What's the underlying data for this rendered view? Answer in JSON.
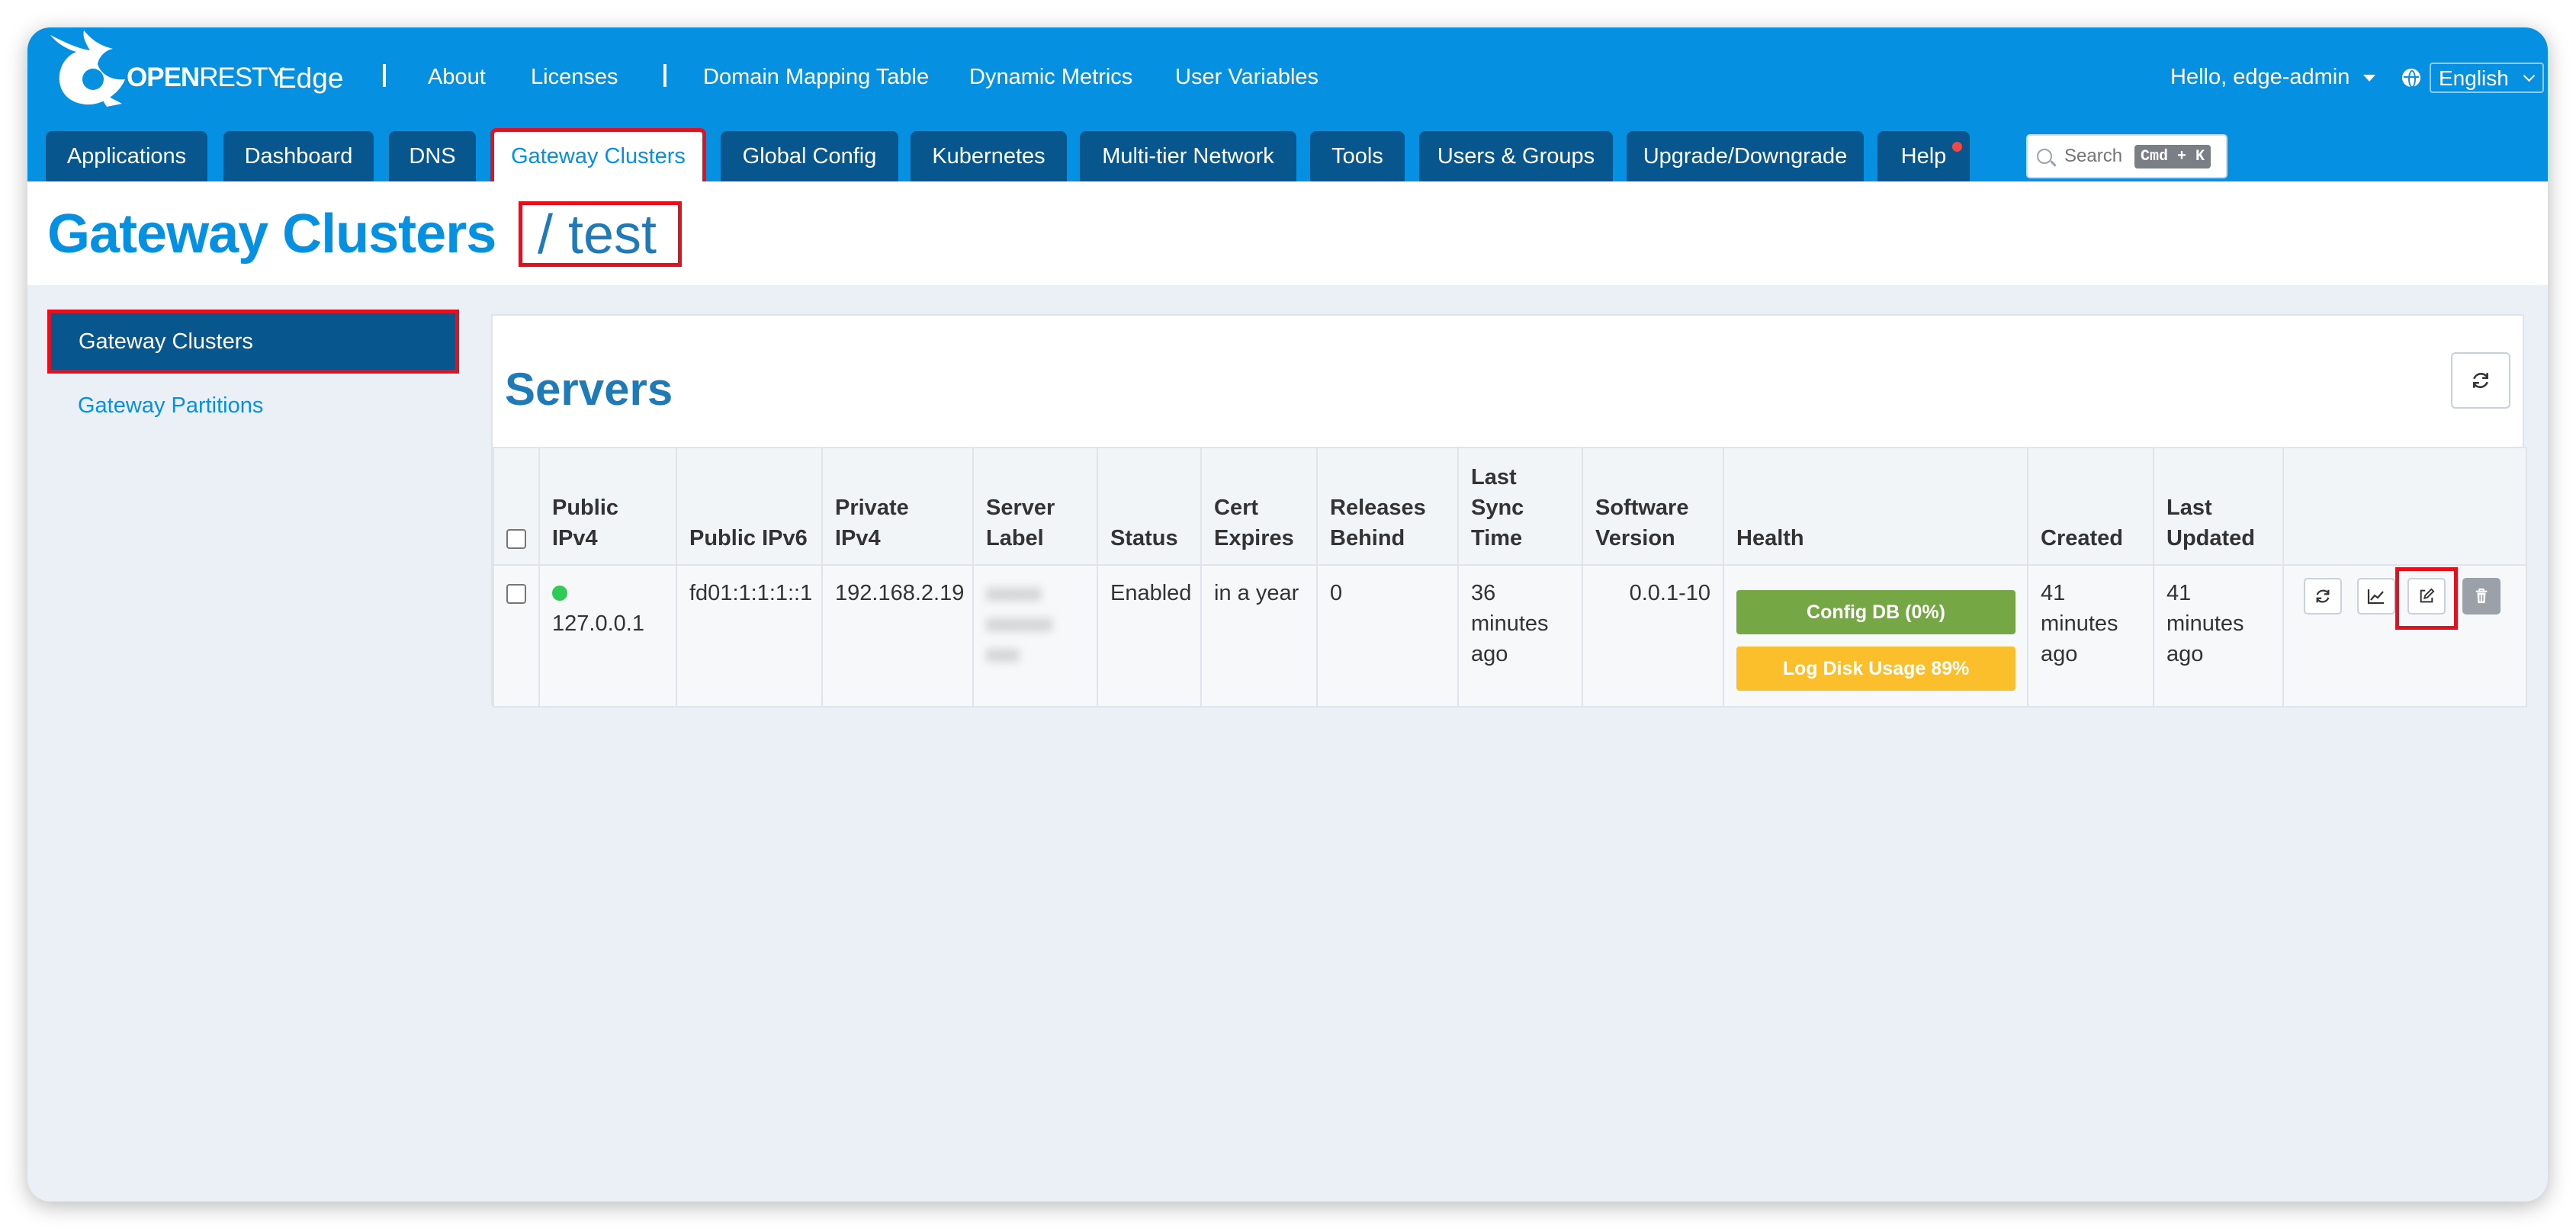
{
  "brand": {
    "logo_main": "OPEN",
    "logo_light": "RESTY",
    "product": "Edge"
  },
  "top_links": [
    "About",
    "Licenses",
    "Domain Mapping Table",
    "Dynamic Metrics",
    "User Variables"
  ],
  "user": {
    "greeting": "Hello, edge-admin"
  },
  "language": {
    "selected": "English"
  },
  "tabs": [
    {
      "label": "Applications"
    },
    {
      "label": "Dashboard"
    },
    {
      "label": "DNS"
    },
    {
      "label": "Gateway Clusters",
      "active": true
    },
    {
      "label": "Global Config"
    },
    {
      "label": "Kubernetes"
    },
    {
      "label": "Multi-tier Network"
    },
    {
      "label": "Tools"
    },
    {
      "label": "Users & Groups"
    },
    {
      "label": "Upgrade/Downgrade"
    },
    {
      "label": "Help",
      "notification": true
    }
  ],
  "search": {
    "placeholder": "Search",
    "shortcut": "Cmd + K"
  },
  "page": {
    "title": "Gateway Clusters",
    "crumb": "/ test"
  },
  "sidebar": {
    "items": [
      {
        "label": "Gateway Clusters",
        "active": true
      },
      {
        "label": "Gateway Partitions"
      }
    ]
  },
  "servers": {
    "title": "Servers",
    "columns": [
      "Public IPv4",
      "Public IPv6",
      "Private IPv4",
      "Server Label",
      "Status",
      "Cert Expires",
      "Releases Behind",
      "Last Sync Time",
      "Software Version",
      "Health",
      "Created",
      "Last Updated"
    ],
    "rows": [
      {
        "public_ipv4": "127.0.0.1",
        "public_ipv6": "fd01:1:1:1::1",
        "private_ipv4": "192.168.2.19",
        "server_label": "xxxxx xxxxxx xxx",
        "status": "Enabled",
        "cert_expires": "in a year",
        "releases_behind": "0",
        "last_sync": "36 minutes ago",
        "software_version": "0.0.1-10",
        "health": [
          "Config DB (0%)",
          "Log Disk Usage 89%"
        ],
        "created": "41 minutes ago",
        "last_updated": "41 minutes ago"
      }
    ]
  },
  "colors": {
    "nav_blue": "#0590e2",
    "tab_dark": "#07578e",
    "highlight_red": "#e3111f",
    "health_green": "#75a745",
    "health_amber": "#fbbf2b",
    "online_green": "#2ecc55"
  }
}
